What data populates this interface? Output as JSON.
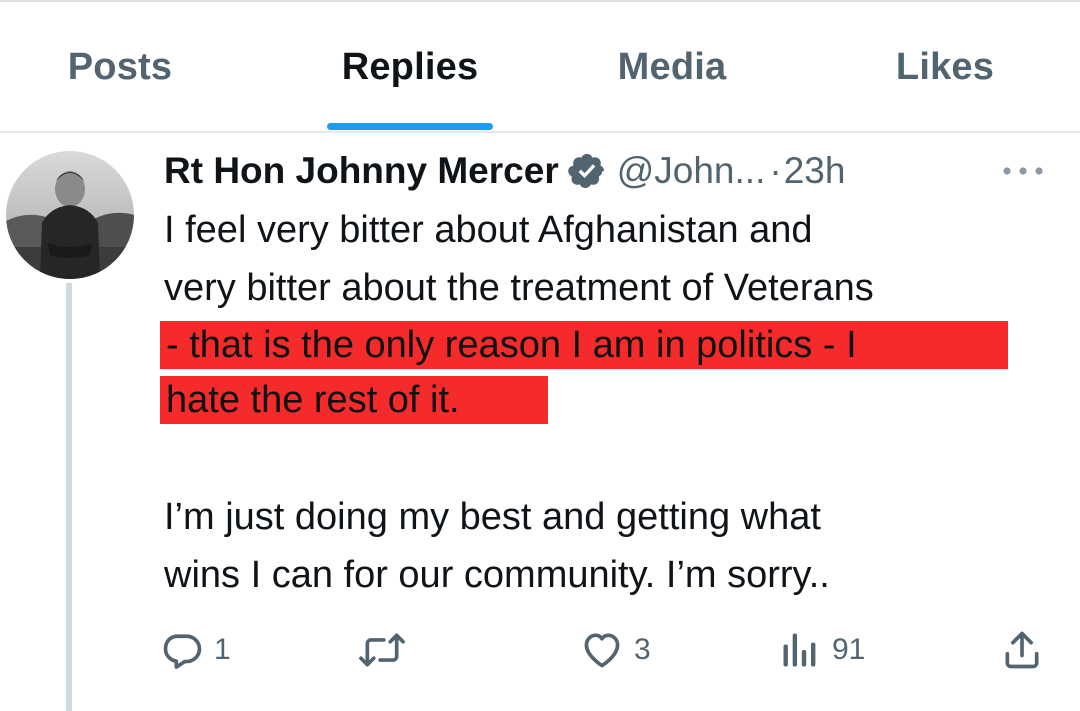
{
  "tabs": [
    {
      "label": "Posts",
      "active": false
    },
    {
      "label": "Replies",
      "active": true
    },
    {
      "label": "Media",
      "active": false
    },
    {
      "label": "Likes",
      "active": false
    }
  ],
  "tweet": {
    "author_name": "Rt Hon Johnny Mercer",
    "handle": "@John...",
    "separator": "·",
    "time": "23h",
    "verified": true,
    "lines": [
      "I feel very bitter about Afghanistan and",
      "very bitter about the treatment of Veterans"
    ],
    "highlighted_lines": [
      "- that is the only reason I am in politics - I",
      "hate the rest of it."
    ],
    "second_paragraph": [
      "I’m just doing my best and getting what",
      "wins I can for our community. I’m sorry.."
    ]
  },
  "actions": {
    "reply": {
      "icon": "reply-icon",
      "count": "1"
    },
    "retweet": {
      "icon": "retweet-icon",
      "count": ""
    },
    "like": {
      "icon": "heart-icon",
      "count": "3"
    },
    "views": {
      "icon": "views-icon",
      "count": "91"
    },
    "share": {
      "icon": "share-icon",
      "count": ""
    }
  },
  "colors": {
    "accent": "#1d9bf0",
    "highlight": "#f52a2a",
    "muted": "#536471",
    "text": "#0f1419"
  }
}
